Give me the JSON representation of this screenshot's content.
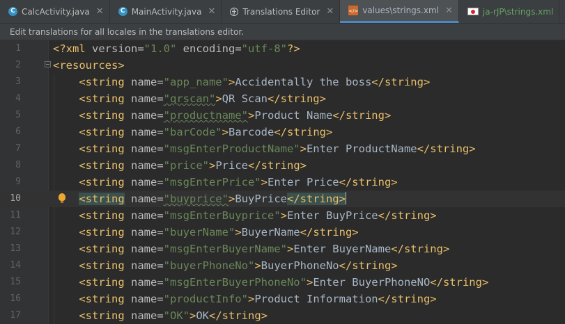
{
  "tabs": [
    {
      "label": "CalcActivity.java",
      "icon": "c-class-icon"
    },
    {
      "label": "MainActivity.java",
      "icon": "c-class-icon"
    },
    {
      "label": "Translations Editor",
      "icon": "globe-icon"
    },
    {
      "label": "values\\strings.xml",
      "icon": "xml-file-icon",
      "active": true
    },
    {
      "label": "ja-rJP\\strings.xml",
      "icon": "japan-flag-icon"
    }
  ],
  "notification": "Edit translations for all locales in the translations editor.",
  "colors": {
    "background": "#2b2b2b",
    "tag": "#e8bf6a",
    "attribute": "#bababa",
    "string_value": "#6a8759",
    "text": "#a9b7c6",
    "active_tab_underline": "#4a88c7"
  },
  "editor": {
    "current_line": 10,
    "prolog": {
      "start": "<?xml ",
      "version_attr": "version=",
      "version_val": "\"1.0\"",
      "encoding_attr": " encoding=",
      "encoding_val": "\"utf-8\"",
      "end": "?>"
    },
    "root_open": "<resources>",
    "string_open": "<string",
    "name_attr": " name=",
    "close_bracket": ">",
    "string_close": "</string>",
    "entries": [
      {
        "line": "3",
        "name": "\"app_name\"",
        "value": "Accidentally the boss"
      },
      {
        "line": "4",
        "name": "\"qrscan\"",
        "value": "QR Scan"
      },
      {
        "line": "5",
        "name": "\"productname\"",
        "value": "Product Name"
      },
      {
        "line": "6",
        "name": "\"barCode\"",
        "value": "Barcode"
      },
      {
        "line": "7",
        "name": "\"msgEnterProductName\"",
        "value": "Enter ProductName"
      },
      {
        "line": "8",
        "name": "\"price\"",
        "value": "Price"
      },
      {
        "line": "9",
        "name": "\"msgEnterPrice\"",
        "value": "Enter Price"
      },
      {
        "line": "10",
        "name": "\"buyprice\"",
        "value": "BuyPrice"
      },
      {
        "line": "11",
        "name": "\"msgEnterBuyprice\"",
        "value": "Enter BuyPrice"
      },
      {
        "line": "12",
        "name": "\"buyerName\"",
        "value": "BuyerName"
      },
      {
        "line": "13",
        "name": "\"msgEnterBuyerName\"",
        "value": "Enter BuyerName"
      },
      {
        "line": "14",
        "name": "\"buyerPhoneNo\"",
        "value": "BuyerPhoneNo"
      },
      {
        "line": "15",
        "name": "\"msgEnterBuyerPhoneNo\"",
        "value": "Enter BuyerPhoneNO"
      },
      {
        "line": "16",
        "name": "\"productInfo\"",
        "value": "Product Information"
      },
      {
        "line": "17",
        "name": "\"OK\"",
        "value": "OK"
      }
    ],
    "line_numbers": [
      "1",
      "2"
    ]
  }
}
